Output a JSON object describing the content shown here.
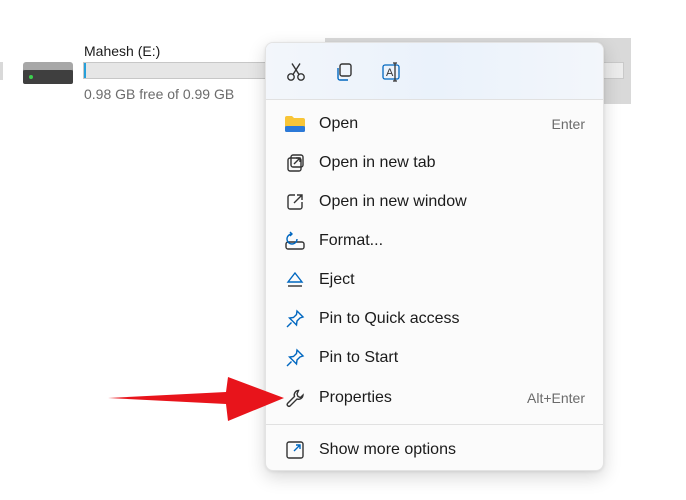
{
  "drive": {
    "name": "Mahesh (E:)",
    "free_text": "0.98 GB free of 0.99 GB",
    "used_fraction": 0.01
  },
  "colors": {
    "menu_bg": "#fbfbfb",
    "accent_blue": "#0067c0",
    "folder_yellow": "#f8c537",
    "arrow_red": "#e8141b",
    "drive_bar": "#26a0da"
  },
  "quick_actions": [
    {
      "icon": "cut-icon",
      "tooltip": "Cut"
    },
    {
      "icon": "copy-icon",
      "tooltip": "Copy"
    },
    {
      "icon": "rename-icon",
      "tooltip": "Rename"
    }
  ],
  "menu": {
    "items": [
      {
        "label": "Open",
        "shortcut": "Enter",
        "icon": "folder-icon"
      },
      {
        "label": "Open in new tab",
        "shortcut": "",
        "icon": "new-tab-icon"
      },
      {
        "label": "Open in new window",
        "shortcut": "",
        "icon": "new-window-icon"
      },
      {
        "label": "Format...",
        "shortcut": "",
        "icon": "format-icon"
      },
      {
        "label": "Eject",
        "shortcut": "",
        "icon": "eject-icon"
      },
      {
        "label": "Pin to Quick access",
        "shortcut": "",
        "icon": "pin-icon"
      },
      {
        "label": "Pin to Start",
        "shortcut": "",
        "icon": "pin-icon"
      },
      {
        "label": "Properties",
        "shortcut": "Alt+Enter",
        "icon": "wrench-icon"
      }
    ],
    "more": {
      "label": "Show more options",
      "icon": "more-options-icon"
    }
  }
}
